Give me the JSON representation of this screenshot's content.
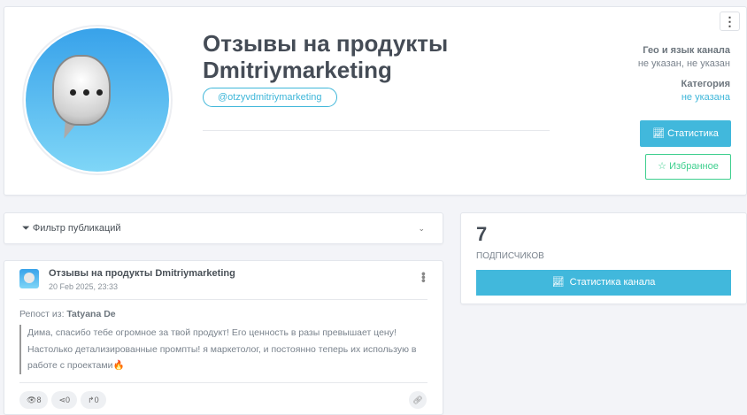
{
  "channel": {
    "title": "Отзывы на продукты Dmitriymarketing",
    "handle": "@otzyvdmitriymarketing",
    "menu_icon": "⋮",
    "geo_label": "Гео и язык канала",
    "geo_value": "не указан, не указан",
    "category_label": "Категория",
    "category_value": "не указана",
    "stats_button": "Статистика",
    "fav_button": "Избранное"
  },
  "filter": {
    "label": "Фильтр публикаций"
  },
  "subscribers": {
    "count": "7",
    "label": "подписчиков",
    "button": "Статистика канала"
  },
  "post": {
    "channel": "Отзывы на продукты Dmitriymarketing",
    "date": "20 Feb 2025, 23:33",
    "repost_label": "Репост из:",
    "repost_author": "Tatyana De",
    "text": "Дима, спасибо тебе огромное за твой продукт! Его ценность в разы превышает цену! Настолько детализированные промпты! я маркетолог, и постоянно теперь их использую в работе с проектами🔥",
    "views": "8",
    "shares": "0",
    "forwards": "0"
  }
}
